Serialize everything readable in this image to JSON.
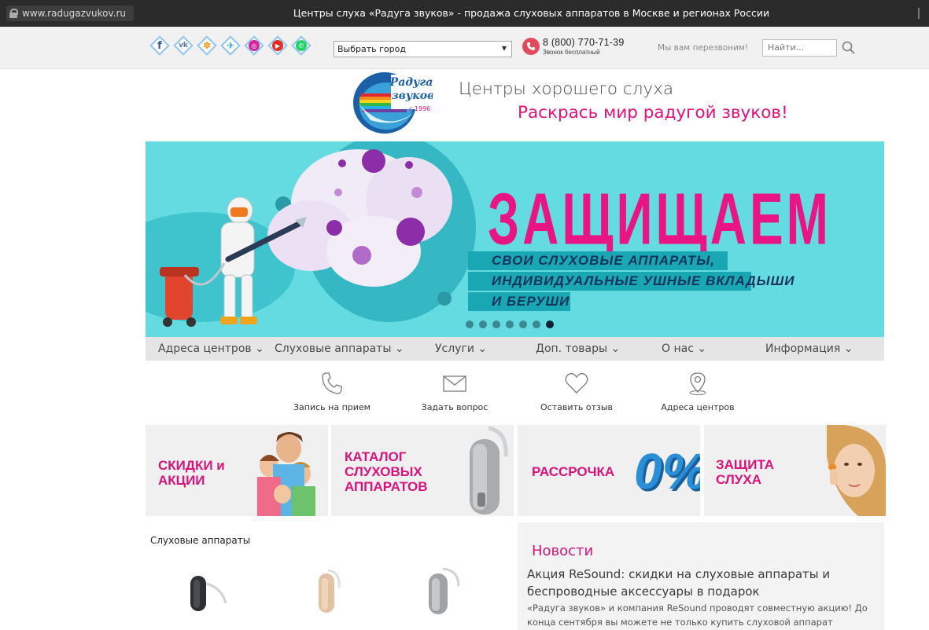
{
  "browser": {
    "url": "www.radugazvukov.ru",
    "window_title": "Центры слуха «Радуга звуков» - продажа слуховых аппаратов в Москве и регионах России"
  },
  "topbar": {
    "social_icons": [
      "facebook-icon",
      "vk-icon",
      "odnoklassniki-icon",
      "twitter-icon",
      "instagram-icon",
      "youtube-icon",
      "whatsapp-icon"
    ],
    "city_select": "Выбрать город",
    "phone": "8 (800) 770-71-39",
    "phone_note": "Звонок бесплатный",
    "callback": "Мы вам перезвоним!",
    "search_placeholder": "Найти..."
  },
  "header": {
    "logo_text": "Радуга звуков",
    "logo_year": "с 1996 г",
    "slogan": "Центры хорошего слуха",
    "tagline": "Раскрась мир радугой звуков!"
  },
  "banner": {
    "title": "ЗАЩИЩАЕМ",
    "lines": [
      "СВОИ СЛУХОВЫЕ АППАРАТЫ,",
      "ИНДИВИДУАЛЬНЫЕ УШНЫЕ ВКЛАДЫШИ",
      "И БЕРУШИ"
    ],
    "slide_count": 7,
    "active_slide": 7
  },
  "nav": [
    "Адреса центров",
    "Слуховые аппараты",
    "Услуги",
    "Доп. товары",
    "О нас",
    "Информация"
  ],
  "quick_links": [
    "Запись на прием",
    "Задать вопрос",
    "Оставить отзыв",
    "Адреса центров"
  ],
  "tiles": [
    {
      "label": "СКИДКИ и\nАКЦИИ"
    },
    {
      "label": "КАТАЛОГ\nСЛУХОВЫХ\nАППАРАТОВ"
    },
    {
      "label": "РАССРОЧКА",
      "badge": "0%"
    },
    {
      "label": "ЗАЩИТА\nСЛУХА"
    }
  ],
  "products": {
    "title": "Слуховые аппараты"
  },
  "news": {
    "title": "Новости",
    "headline": "Акция ReSound: скидки на слуховые аппараты и беспроводные аксессуары в подарок",
    "text": "«Радуга звуков» и компания ReSound проводят совместную акцию! До конца сентября вы можете не только купить слуховой аппарат"
  },
  "colors": {
    "accent": "#e2117a",
    "banner_bg": "#64dbe0",
    "nav_bg": "#e5e5e5"
  }
}
